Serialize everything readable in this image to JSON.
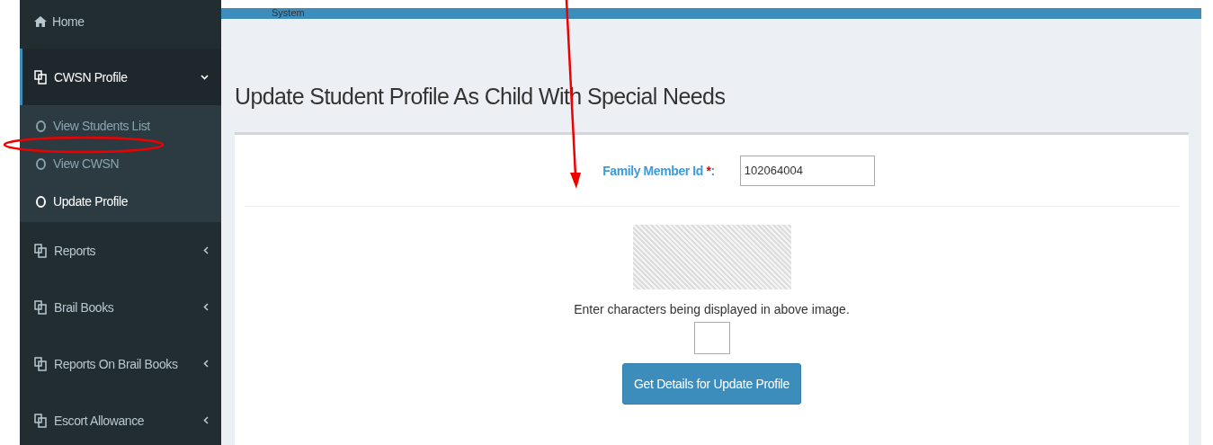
{
  "header": {
    "title": "System"
  },
  "sidebar": {
    "items": [
      {
        "kind": "home",
        "label": "Home"
      },
      {
        "kind": "group",
        "label": "CWSN Profile",
        "expanded": true,
        "children": [
          {
            "label": "View Students List",
            "selected": false
          },
          {
            "label": "View CWSN",
            "selected": false
          },
          {
            "label": "Update Profile",
            "selected": true
          }
        ]
      },
      {
        "kind": "group",
        "label": "Reports",
        "expanded": false
      },
      {
        "kind": "group",
        "label": "Brail Books",
        "expanded": false
      },
      {
        "kind": "group",
        "label": "Reports On Brail Books",
        "expanded": false
      },
      {
        "kind": "group",
        "label": "Escort Allowance",
        "expanded": false
      }
    ]
  },
  "page": {
    "title": "Update Student Profile As Child With Special Needs"
  },
  "form": {
    "family_member_label": "Family Member Id",
    "required_mark": "*",
    "label_colon": ":",
    "family_member_value": "102064004",
    "captcha_instruction": "Enter characters being displayed in above image.",
    "submit_button": "Get Details for Update Profile"
  }
}
